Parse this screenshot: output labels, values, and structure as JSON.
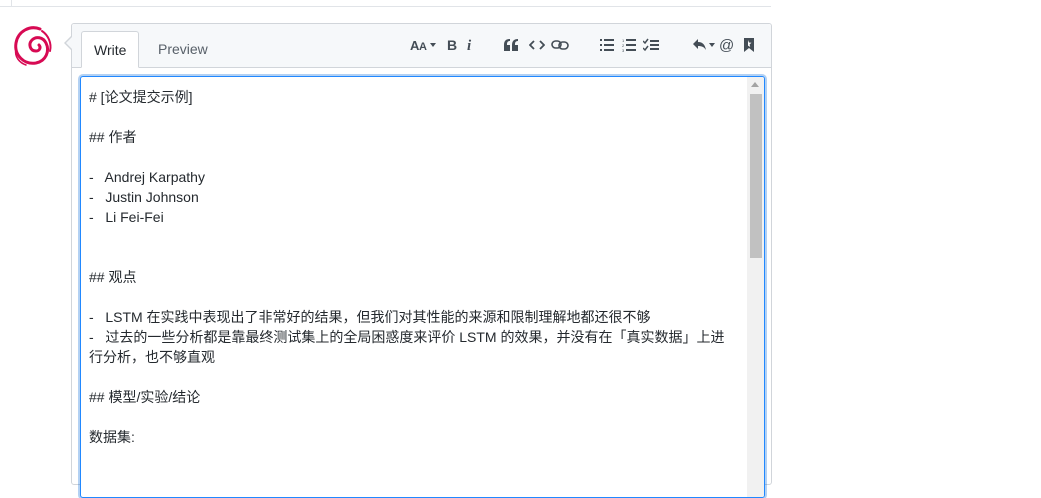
{
  "tabs": {
    "write": "Write",
    "preview": "Preview"
  },
  "toolbar": {
    "icons": [
      "text-size-icon",
      "bold-icon",
      "italic-icon",
      "quote-icon",
      "code-icon",
      "link-icon",
      "unordered-list-icon",
      "ordered-list-icon",
      "task-list-icon",
      "reply-icon",
      "mention-icon",
      "bookmark-icon"
    ]
  },
  "editor": {
    "lines": [
      "# [论文提交示例]",
      "",
      "## 作者",
      "",
      "-   Andrej Karpathy",
      "-   Justin Johnson",
      "-   Li Fei-Fei",
      "",
      "",
      "## 观点",
      "",
      "-   LSTM 在实践中表现出了非常好的结果，但我们对其性能的来源和限制理解地都还很不够",
      "-   过去的一些分析都是靠最终测试集上的全局困惑度来评价 LSTM 的效果，并没有在「真实数据」上进",
      "行分析，也不够直观",
      "",
      "## 模型/实验/结论",
      "",
      "数据集:"
    ]
  },
  "colors": {
    "accent": "#2188ff",
    "avatar": "#d70a53"
  }
}
